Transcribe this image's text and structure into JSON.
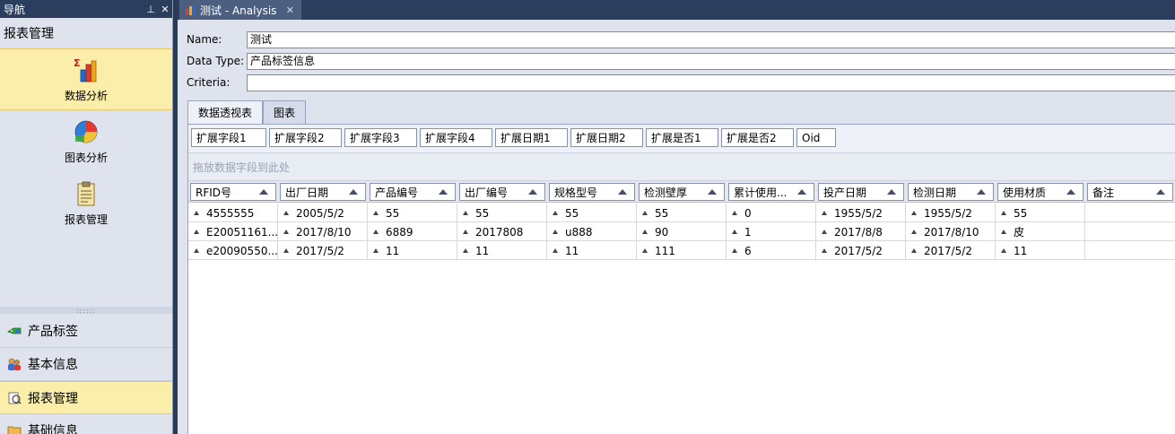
{
  "nav": {
    "title": "导航",
    "pin_glyph": "⊥",
    "close_glyph": "✕",
    "group_title": "报表管理",
    "big_items": [
      {
        "label": "数据分析",
        "icon": "bar-chart-icon",
        "selected": true
      },
      {
        "label": "图表分析",
        "icon": "pie-chart-icon",
        "selected": false
      },
      {
        "label": "报表管理",
        "icon": "clipboard-icon",
        "selected": false
      }
    ],
    "splitter_glyph": "::::::",
    "small_items": [
      {
        "label": "产品标签",
        "icon": "tag-icon",
        "selected": false
      },
      {
        "label": "基本信息",
        "icon": "users-icon",
        "selected": false
      },
      {
        "label": "报表管理",
        "icon": "report-icon",
        "selected": true
      },
      {
        "label": "基础信息",
        "icon": "folder-icon",
        "selected": false
      }
    ]
  },
  "doc_tab": {
    "title": "测试 - Analysis",
    "close_glyph": "✕"
  },
  "form": {
    "name_label": "Name:",
    "name_value": "测试",
    "datatype_label": "Data Type:",
    "datatype_value": "产品标签信息",
    "criteria_label": "Criteria:",
    "criteria_value": ""
  },
  "inner_tabs": [
    {
      "label": "数据透视表",
      "active": true
    },
    {
      "label": "图表",
      "active": false
    }
  ],
  "filter_fields": [
    "扩展字段1",
    "扩展字段2",
    "扩展字段3",
    "扩展字段4",
    "扩展日期1",
    "扩展日期2",
    "扩展是否1",
    "扩展是否2",
    "Oid"
  ],
  "drop_hint": "拖放数据字段到此处",
  "grid": {
    "columns": [
      "RFID号",
      "出厂日期",
      "产品编号",
      "出厂编号",
      "规格型号",
      "检测壁厚",
      "累计使用...",
      "投产日期",
      "检测日期",
      "使用材质",
      "备注"
    ],
    "rows": [
      [
        "4555555",
        "2005/5/2",
        "55",
        "55",
        "55",
        "55",
        "0",
        "1955/5/2",
        "1955/5/2",
        "55",
        ""
      ],
      [
        "E20051161...",
        "2017/8/10",
        "6889",
        "2017808",
        "u888",
        "90",
        "1",
        "2017/8/8",
        "2017/8/10",
        "皮",
        ""
      ],
      [
        "e20090550...",
        "2017/5/2",
        "11",
        "11",
        "11",
        "111",
        "6",
        "2017/5/2",
        "2017/5/2",
        "11",
        ""
      ]
    ]
  }
}
